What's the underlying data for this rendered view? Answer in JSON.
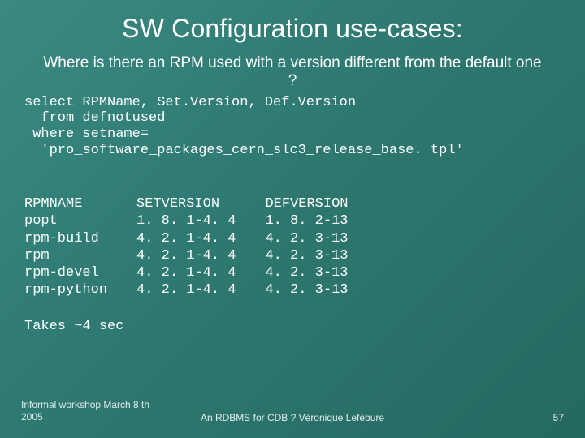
{
  "title": "SW Configuration use-cases:",
  "subtitle": "Where is there an RPM used with a version different from the default one ?",
  "query": {
    "line1": "select RPMName, Set.Version, Def.Version",
    "line2": "  from defnotused",
    "line3": " where setname=",
    "line4": "  'pro_software_packages_cern_slc3_release_base. tpl'"
  },
  "results": {
    "col1": {
      "header": "RPMNAME",
      "rows": [
        "popt",
        "rpm-build",
        "rpm",
        "rpm-devel",
        "rpm-python"
      ]
    },
    "col2": {
      "header": "SETVERSION",
      "rows": [
        "1. 8. 1-4. 4",
        "4. 2. 1-4. 4",
        "4. 2. 1-4. 4",
        "4. 2. 1-4. 4",
        "4. 2. 1-4. 4"
      ]
    },
    "col3": {
      "header": "DEFVERSION",
      "rows": [
        "1. 8. 2-13",
        "4. 2. 3-13",
        "4. 2. 3-13",
        "4. 2. 3-13",
        "4. 2. 3-13"
      ]
    }
  },
  "timing": "Takes ~4 sec",
  "footer": {
    "left": "Informal workshop March 8 th 2005",
    "center": "An RDBMS for CDB ? Véronique Lefébure",
    "right": "57"
  }
}
